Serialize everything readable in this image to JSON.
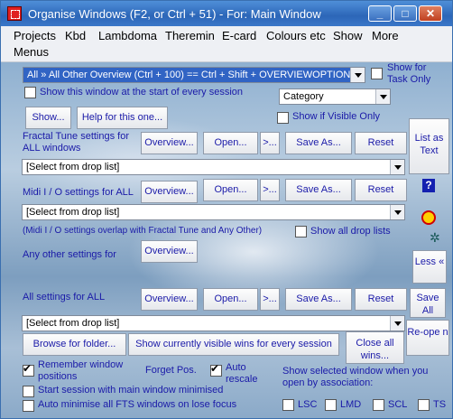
{
  "window": {
    "title": "Organise Windows (F2, or Ctrl + 51) - For: Main Window"
  },
  "menu": [
    "Projects",
    "Kbd",
    "Lambdoma",
    "Theremin",
    "E-card",
    "Colours etc",
    "Show",
    "More",
    "Menus"
  ],
  "top": {
    "overview_select": "All »  All Other Overview (Ctrl + 100) == Ctrl + Shift + OVERVIEWOPTIONS",
    "show_for_task_only": "Show for Task Only",
    "show_at_start": "Show this window at the start of every session",
    "category_select": "Category",
    "show_button": "Show...",
    "help_button": "Help for this one...",
    "show_if_visible": "Show if Visible Only"
  },
  "fractal": {
    "label": "Fractal Tune settings for ALL windows",
    "overview": "Overview...",
    "open": "Open...",
    "arrow": ">...",
    "save_as": "Save As...",
    "reset": "Reset",
    "select": "[Select from drop list]"
  },
  "midi": {
    "label": "Midi I / O settings for ALL",
    "overview": "Overview...",
    "open": "Open...",
    "arrow": ">...",
    "save_as": "Save As...",
    "reset": "Reset",
    "select": "[Select from drop list]",
    "note": "(Midi I / O settings overlap with Fractal Tune and Any Other)",
    "show_all_drop": "Show all drop lists"
  },
  "any_other": {
    "label": "Any other settings for",
    "overview": "Overview..."
  },
  "all_settings": {
    "label": "All settings for ALL",
    "overview": "Overview...",
    "open": "Open...",
    "arrow": ">...",
    "save_as": "Save As...",
    "reset": "Reset",
    "select": "[Select from drop list]"
  },
  "side": {
    "list_as_text": "List as Text",
    "less": "Less «",
    "save_all": "Save All",
    "reopen": "Re-ope n"
  },
  "bottom": {
    "browse": "Browse for folder...",
    "show_visible": "Show currently visible wins for every session",
    "close_all": "Close all wins...",
    "remember": "Remember window positions",
    "forget": "Forget Pos.",
    "auto_rescale": "Auto rescale",
    "start_minimised": "Start session with main window minimised",
    "auto_minimise": "Auto minimise all FTS windows on lose focus",
    "show_selected": "Show selected window when you open by association:",
    "opts": [
      "LSC",
      "LMD",
      "SCL",
      "TS"
    ]
  },
  "colors": {
    "label_blue": "#1a1aa8",
    "title_blue": "#2c66b8",
    "select_highlight": "#3164c4"
  }
}
